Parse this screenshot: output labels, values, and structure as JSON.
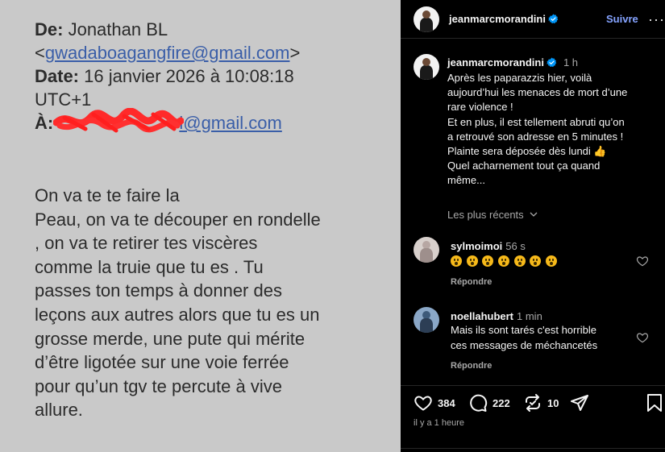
{
  "photo": {
    "from_label": "De:",
    "from_name": "Jonathan BL",
    "from_email_open": "<",
    "from_email": "gwadaboagangfire@gmail.com",
    "from_email_close": ">",
    "date_label": "Date:",
    "date_value": "16 janvier 2026 à 10:08:18",
    "timezone": "UTC+1",
    "to_label": "À:",
    "to_email_visible": "i@gmail.com",
    "body_lines": [
      "On va te te faire la",
      "Peau, on va te découper en rondelle",
      ", on va te retirer tes viscères",
      "comme la truie que tu es . Tu",
      "passes ton temps à donner des",
      "leçons aux autres alors que tu es un",
      "grosse merde, une pute qui mérite",
      "d’être ligotée sur une voie ferrée",
      "pour qu’un tgv te percute à vive",
      "allure."
    ]
  },
  "post": {
    "username": "jeanmarcmorandini",
    "follow_label": "Suivre",
    "more_label": "···",
    "time": "1 h",
    "caption_lines": [
      "Après les paparazzis hier, voilà",
      "aujourd’hui les menaces de mort d’une",
      "rare violence !",
      "Et en plus, il est tellement abruti qu’on",
      "a retrouvé son adresse en 5 minutes !",
      "Plainte sera déposée dès lundi 👍",
      "Quel acharnement tout ça quand",
      "même..."
    ],
    "sort_label": "Les plus récents",
    "comments": [
      {
        "user": "sylmoimoi",
        "time": "56 s",
        "emoji_count": 7,
        "text": "",
        "reply": "Répondre"
      },
      {
        "user": "noellahubert",
        "time": "1 min",
        "text_lines": [
          "Mais ils sont tarés c'est horrible",
          "ces messages de méchancetés"
        ],
        "reply": "Répondre"
      }
    ],
    "likes": "384",
    "comments_count": "222",
    "reposts": "10",
    "posted_ago": "il y a 1 heure"
  },
  "colors": {
    "accent_blue": "#85a3ff",
    "verified_blue": "#0095f6",
    "muted": "#a8a8a8",
    "redaction": "#ff2a2a",
    "link": "#3a5ea8"
  },
  "icons": [
    "verified-icon",
    "heart-icon",
    "comment-icon",
    "repost-icon",
    "share-icon",
    "bookmark-icon",
    "chevron-down-icon"
  ]
}
